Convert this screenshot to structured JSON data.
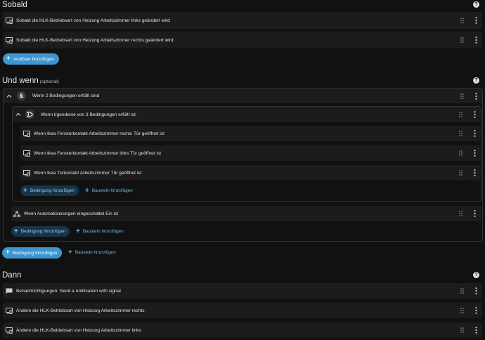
{
  "sections": {
    "trigger": {
      "title": "Sobald"
    },
    "condition": {
      "title": "Und wenn",
      "optional": "(optional)"
    },
    "action": {
      "title": "Dann"
    }
  },
  "triggers": [
    {
      "label": "Sobald die HLK-Betriebsart von Heizung Arbeitszimmer links geändert wird",
      "icon": "device-icon"
    },
    {
      "label": "Sobald die HLK-Betriebsart von Heizung Arbeitszimmer rechts geändert wird",
      "icon": "device-icon"
    }
  ],
  "trigger_add": "Auslöser hinzufügen",
  "conditions": {
    "and_block": {
      "label": "Wenn 2 Bedingungen erfüllt sind",
      "icon": "ampersand-icon"
    },
    "or_block": {
      "label": "Wenn irgendeine von 3 Bedingungen erfüllt ist.",
      "icon": "or-gate-icon"
    },
    "or_items": [
      {
        "label": "Wenn Ikea Fensterkontakt Arbeitszimmer rechts Tür geöffnet ist",
        "icon": "device-icon"
      },
      {
        "label": "Wenn Ikea Fensterkontakt Arbeitszimmer links Tür geöffnet ist",
        "icon": "device-icon"
      },
      {
        "label": "Wenn Ikea Türkontakt Arbeitszimmer Tür geöffnet ist",
        "icon": "device-icon"
      }
    ],
    "automation_item": {
      "label": "Wenn Automatisierungen eingeschaltet Ein ist",
      "icon": "nodes-icon"
    },
    "add_condition": "Bedingung hinzufügen",
    "add_block": "Baustein hinzufügen"
  },
  "actions": [
    {
      "label": "Benachrichtigungen: Send a notification with signal",
      "icon": "message-icon"
    },
    {
      "label": "Ändere die HLK-Betriebsart von Heizung Arbeitszimmer rechts",
      "icon": "device-icon"
    },
    {
      "label": "Ändere die HLK-Betriebsart von Heizung Arbeitszimmer links",
      "icon": "device-icon"
    }
  ],
  "help_glyph": "?",
  "colors": {
    "primary": "#3d96cf",
    "row_bg": "#1c1c1c",
    "page_bg": "#111111"
  }
}
